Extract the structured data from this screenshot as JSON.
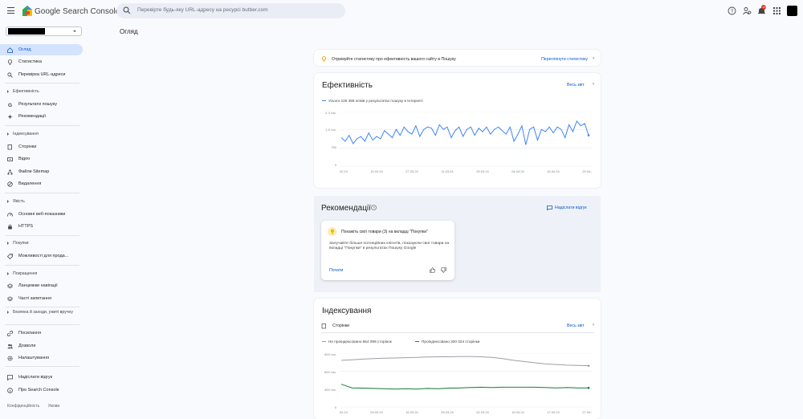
{
  "header": {
    "brand": "Google Search Console",
    "search_placeholder": "Перевірте будь-яку URL-адресу на ресурсі butber.com",
    "notifications_count": "13"
  },
  "page": {
    "title": "Огляд"
  },
  "sidebar": {
    "items": [
      {
        "label": "Огляд",
        "icon": "home-icon"
      },
      {
        "label": "Статистика",
        "icon": "bulb-icon"
      },
      {
        "label": "Перевірка URL-адреси",
        "icon": "search-icon"
      }
    ],
    "sections": [
      {
        "label": "Ефективність",
        "items": [
          {
            "label": "Результати пошуку",
            "icon": "google-g-icon"
          },
          {
            "label": "Рекомендації",
            "icon": "sparkle-icon"
          }
        ]
      },
      {
        "label": "Індексування",
        "items": [
          {
            "label": "Сторінки",
            "icon": "pages-icon"
          },
          {
            "label": "Відео",
            "icon": "video-icon"
          },
          {
            "label": "Файли Sitemap",
            "icon": "sitemap-icon"
          },
          {
            "label": "Видалення",
            "icon": "removal-icon"
          }
        ]
      },
      {
        "label": "Якість",
        "items": [
          {
            "label": "Основні веб-показники",
            "icon": "speed-icon"
          },
          {
            "label": "HTTPS",
            "icon": "lock-icon"
          }
        ]
      },
      {
        "label": "Покупки",
        "items": [
          {
            "label": "Можливості для прода...",
            "icon": "tag-icon"
          }
        ]
      },
      {
        "label": "Покращення",
        "items": [
          {
            "label": "Ланцюжки навігації",
            "icon": "layers-icon"
          },
          {
            "label": "Часті запитання",
            "icon": "layers-icon"
          }
        ]
      },
      {
        "label": "Безпека й заходи, ужиті вручну",
        "items": [
          {
            "label": "Посилання",
            "icon": "link-icon"
          },
          {
            "label": "Дозволи",
            "icon": "people-icon"
          },
          {
            "label": "Налаштування",
            "icon": "settings-icon"
          }
        ]
      }
    ],
    "bottom_items": [
      {
        "label": "Надіслати відгук",
        "icon": "feedback-icon"
      },
      {
        "label": "Про Search Console",
        "icon": "info-icon"
      }
    ],
    "footer": {
      "privacy": "Конфіденційність",
      "terms": "Умови"
    }
  },
  "insights": {
    "text": "Отримуйте статистику про ефективність вашого сайту в Пошуку",
    "link": "Переглянути статистику"
  },
  "performance": {
    "title": "Ефективність",
    "full_report": "Весь звіт",
    "legend": "Усього 126 455 кліків у результатах пошуку в Інтернеті",
    "color": "#4285f4"
  },
  "recommendations": {
    "title": "Рекомендації",
    "feedback": "Надіслати відгук",
    "card": {
      "title": "Покажіть свої товари (3) на вкладці \"Покупки\"",
      "body": "Залучайте більше потенційних клієнтів, показуючи свої товари на вкладці \"Покупки\" в результатах Пошуку Google",
      "start": "Почати"
    }
  },
  "indexing": {
    "title": "Індексування",
    "row_label": "Сторінки",
    "full_report": "Весь звіт",
    "legend_not_indexed": "Не проіндексовано 664 099 сторінок",
    "legend_indexed": "Проіндексовано 320 024 сторінки",
    "color_not_indexed": "#9aa0a6",
    "color_indexed": "#188038"
  },
  "chart_data": [
    {
      "type": "line",
      "title": "Ефективність",
      "series": [
        {
          "name": "Усього 126 455 кліків у результатах пошуку в Інтернеті",
          "values": [
            1200,
            1050,
            1300,
            950,
            1150,
            1250,
            1050,
            1400,
            1100,
            1250,
            1150,
            1500,
            1350,
            1200,
            1550,
            1300,
            1650,
            1450,
            1350,
            1700,
            1250,
            1550,
            1650,
            1600,
            1300,
            1750,
            1550,
            1650,
            1200,
            1500,
            1650,
            1250,
            1550,
            1650,
            1300,
            1600,
            1450,
            1650,
            1350,
            1550,
            1650,
            1500,
            1350,
            1650,
            1050,
            1350,
            1700,
            900,
            1550,
            1650,
            1100,
            1550,
            1450,
            1650,
            1400,
            1650,
            1550,
            1200,
            1750,
            1450,
            1900,
            1700,
            1800,
            1300
          ]
        }
      ],
      "x": [
        "19.02.24",
        "10.03.24",
        "27.03.24",
        "11.03.24",
        "29.03.24",
        "04.04.24",
        "16.04.24",
        "29.04.24"
      ],
      "yticks": [
        "0",
        "750",
        "1,5 тис.",
        "2,3 тис."
      ],
      "ylim": [
        0,
        2300
      ]
    },
    {
      "type": "line",
      "title": "Індексування",
      "series": [
        {
          "name": "Не проіндексовано 664 099 сторінок",
          "values": [
            780000,
            790000,
            800000,
            810000,
            815000,
            820000,
            825000,
            830000,
            835000,
            840000,
            840000,
            845000,
            845000,
            840000,
            830000,
            810000,
            780000,
            760000,
            740000,
            720000,
            710000,
            700000,
            695000,
            690000
          ]
        },
        {
          "name": "Проіндексовано 320 024 сторінки",
          "values": [
            380000,
            320000,
            315000,
            310000,
            305000,
            300000,
            305000,
            300000,
            310000,
            305000,
            315000,
            320000,
            325000,
            330000,
            325000,
            330000,
            330000,
            330000,
            330000,
            325000,
            320000,
            325000,
            320000,
            320024
          ]
        }
      ],
      "x": [
        "22.02.24",
        "03.03.24",
        "16.03.24",
        "25.03.24",
        "02.03.24",
        "15.04.24",
        "17.04.24",
        "27.04.24"
      ],
      "yticks": [
        "0",
        "300 тис.",
        "600 тис.",
        "900 тис."
      ],
      "ylim": [
        0,
        900000
      ]
    }
  ]
}
